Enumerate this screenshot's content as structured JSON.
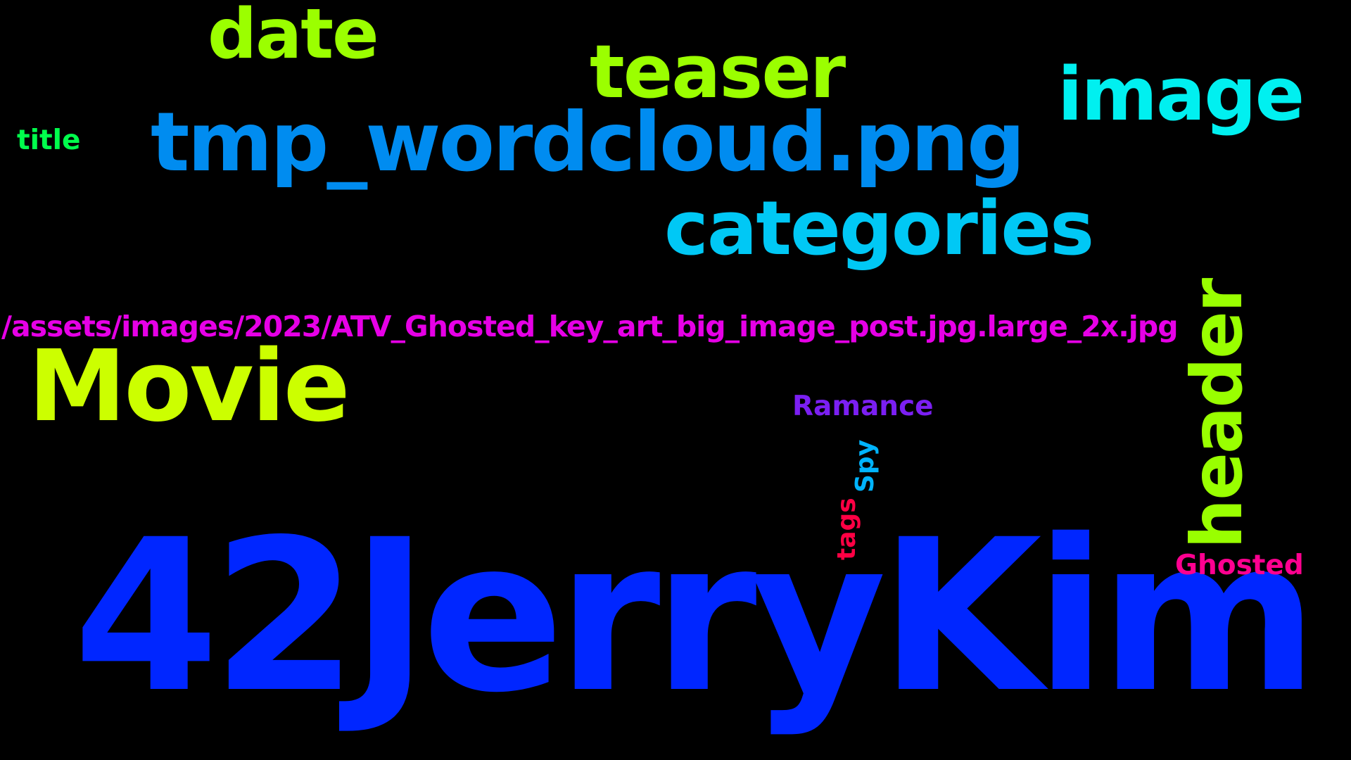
{
  "background": "#000000",
  "words": [
    {
      "id": "42jerrykim",
      "text": "42JerryKim",
      "color": "#0026ff",
      "orientation": "horizontal"
    },
    {
      "id": "tmp",
      "text": "tmp_wordcloud.png",
      "color": "#008cf0",
      "orientation": "horizontal"
    },
    {
      "id": "movie",
      "text": "Movie",
      "color": "#ccff00",
      "orientation": "horizontal"
    },
    {
      "id": "categories",
      "text": "categories",
      "color": "#00c8f5",
      "orientation": "horizontal"
    },
    {
      "id": "teaser",
      "text": "teaser",
      "color": "#9bff00",
      "orientation": "horizontal"
    },
    {
      "id": "image",
      "text": "image",
      "color": "#00f0f0",
      "orientation": "horizontal"
    },
    {
      "id": "date",
      "text": "date",
      "color": "#9bff00",
      "orientation": "horizontal"
    },
    {
      "id": "path",
      "text": "/assets/images/2023/ATV_Ghosted_key_art_big_image_post.jpg.large_2x.jpg",
      "color": "#e600e6",
      "orientation": "horizontal"
    },
    {
      "id": "header",
      "text": "header",
      "color": "#99ff00",
      "orientation": "vertical"
    },
    {
      "id": "ramance",
      "text": "Ramance",
      "color": "#7b1ff2",
      "orientation": "horizontal"
    },
    {
      "id": "ghosted",
      "text": "Ghosted",
      "color": "#ff0090",
      "orientation": "horizontal"
    },
    {
      "id": "title",
      "text": "title",
      "color": "#00ff4c",
      "orientation": "horizontal"
    },
    {
      "id": "spy",
      "text": "Spy",
      "color": "#00b4ff",
      "orientation": "vertical"
    },
    {
      "id": "tags",
      "text": "tags",
      "color": "#ff0044",
      "orientation": "vertical"
    }
  ]
}
